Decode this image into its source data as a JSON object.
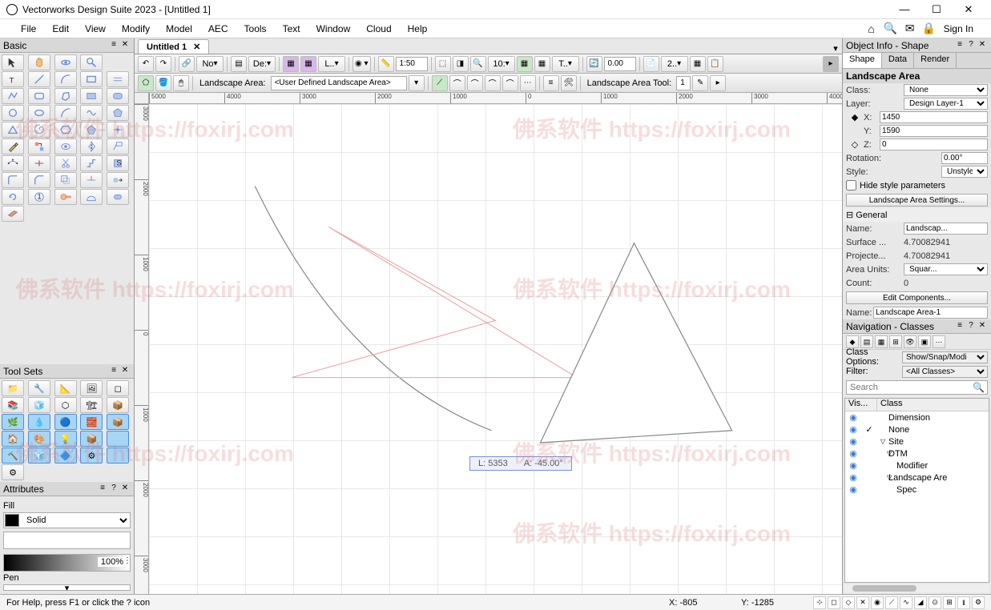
{
  "title": "Vectorworks Design Suite 2023 - [Untitled 1]",
  "menus": [
    "File",
    "Edit",
    "View",
    "Modify",
    "Model",
    "AEC",
    "Tools",
    "Text",
    "Window",
    "Cloud",
    "Help"
  ],
  "signin": "Sign In",
  "leftPalette": {
    "basic": "Basic",
    "toolsets": "Tool Sets",
    "attributes": "Attributes",
    "fill_label": "Fill",
    "pen_label": "Pen",
    "fill_type": "Solid",
    "zoom_pct": "100%"
  },
  "tab": {
    "name": "Untitled 1"
  },
  "toolbar1": {
    "noLabel": "No",
    "deLabel": "De:",
    "lLabel": "L..",
    "scale": "1:50",
    "tLabel": "T..",
    "aspect": "10:",
    "zeroVal": "0.00",
    "twoDot": "2.."
  },
  "toolbar2": {
    "la_label": "Landscape Area:",
    "la_value": "<User Defined Landscape Area>",
    "tool_label": "Landscape Area Tool:",
    "tool_val": "1"
  },
  "rulersH": [
    "5000",
    "4000",
    "3000",
    "2000",
    "1000",
    "0",
    "1000",
    "2000",
    "3000",
    "4000"
  ],
  "rulersV": [
    "3000",
    "2000",
    "1000",
    "0",
    "1000",
    "2000",
    "3000"
  ],
  "tooltip": {
    "L": "L: 5353",
    "A": "A: -45.00°"
  },
  "objInfo": {
    "panel_title": "Object Info - Shape",
    "tabs": [
      "Shape",
      "Data",
      "Render"
    ],
    "heading": "Landscape Area",
    "class_k": "Class:",
    "class_v": "None",
    "layer_k": "Layer:",
    "layer_v": "Design Layer-1",
    "x_k": "X:",
    "x_v": "1450",
    "y_k": "Y:",
    "y_v": "1590",
    "z_k": "Z:",
    "z_v": "0",
    "rot_k": "Rotation:",
    "rot_v": "0.00°",
    "style_k": "Style:",
    "style_v": "Unstyled",
    "hide_cb": "Hide style parameters",
    "settings_btn": "Landscape Area Settings...",
    "general": "General",
    "name_k": "Name:",
    "name_v": "Landscap...",
    "surf_k": "Surface ...",
    "surf_v": "4.70082941",
    "proj_k": "Projecte...",
    "proj_v": "4.70082941",
    "au_k": "Area Units:",
    "au_v": "Squar...",
    "count_k": "Count:",
    "count_v": "0",
    "editcomp_btn": "Edit Components...",
    "bname_k": "Name:",
    "bname_v": "Landscape Area-1"
  },
  "nav": {
    "title": "Navigation - Classes",
    "co_k": "Class Options:",
    "co_v": "Show/Snap/Modi",
    "filter_k": "Filter:",
    "filter_v": "<All Classes>",
    "search_ph": "Search",
    "hdr_vis": "Vis...",
    "hdr_class": "Class",
    "items": [
      {
        "name": "Dimension",
        "indent": 0,
        "check": false,
        "tri": ""
      },
      {
        "name": "None",
        "indent": 0,
        "check": true,
        "tri": ""
      },
      {
        "name": "Site",
        "indent": 0,
        "check": false,
        "tri": "▽"
      },
      {
        "name": "DTM",
        "indent": 1,
        "check": false,
        "tri": "▽"
      },
      {
        "name": "Modifier",
        "indent": 2,
        "check": false,
        "tri": ""
      },
      {
        "name": "Landscape Are",
        "indent": 1,
        "check": false,
        "tri": "▽"
      },
      {
        "name": "Spec",
        "indent": 2,
        "check": false,
        "tri": ""
      }
    ]
  },
  "status": {
    "help": "For Help, press F1 or click the ? icon",
    "x": "X: -805",
    "y": "Y: -1285"
  },
  "watermarks": [
    "佛系软件 https://foxirj.com"
  ]
}
